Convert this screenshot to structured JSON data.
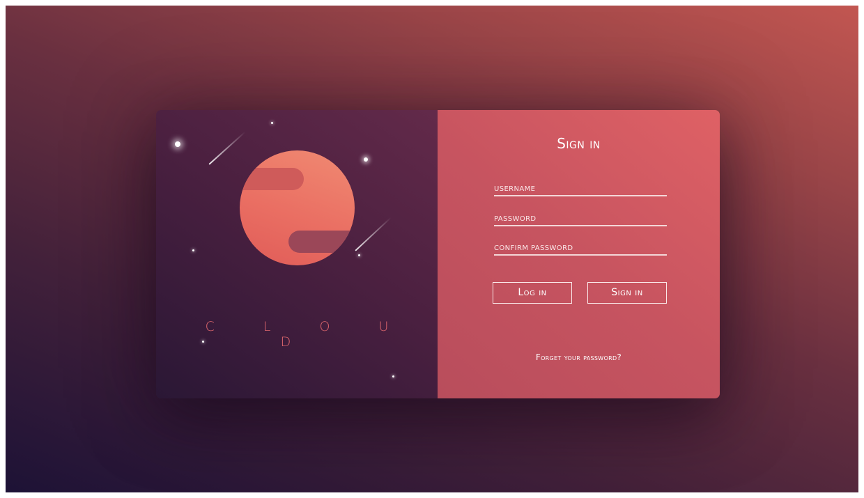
{
  "brand": {
    "name": "C L O U D"
  },
  "form": {
    "title": "Sign in",
    "fields": [
      {
        "label": "USERNAME"
      },
      {
        "label": "PASSWORD"
      },
      {
        "label": "CONFIRM PASSWORD"
      }
    ],
    "login_button": "Log in",
    "signin_button": "Sign in",
    "forgot_link": "Forget your password?"
  },
  "colors": {
    "background_dark": "#1d1236",
    "background_light": "#c25651",
    "left_panel": "#4b2040",
    "right_panel": "#c75460",
    "planet": "#ea6f63",
    "brand_text": "#e0676e"
  },
  "icons": {
    "illustration": "planet-with-stars-illustration"
  }
}
